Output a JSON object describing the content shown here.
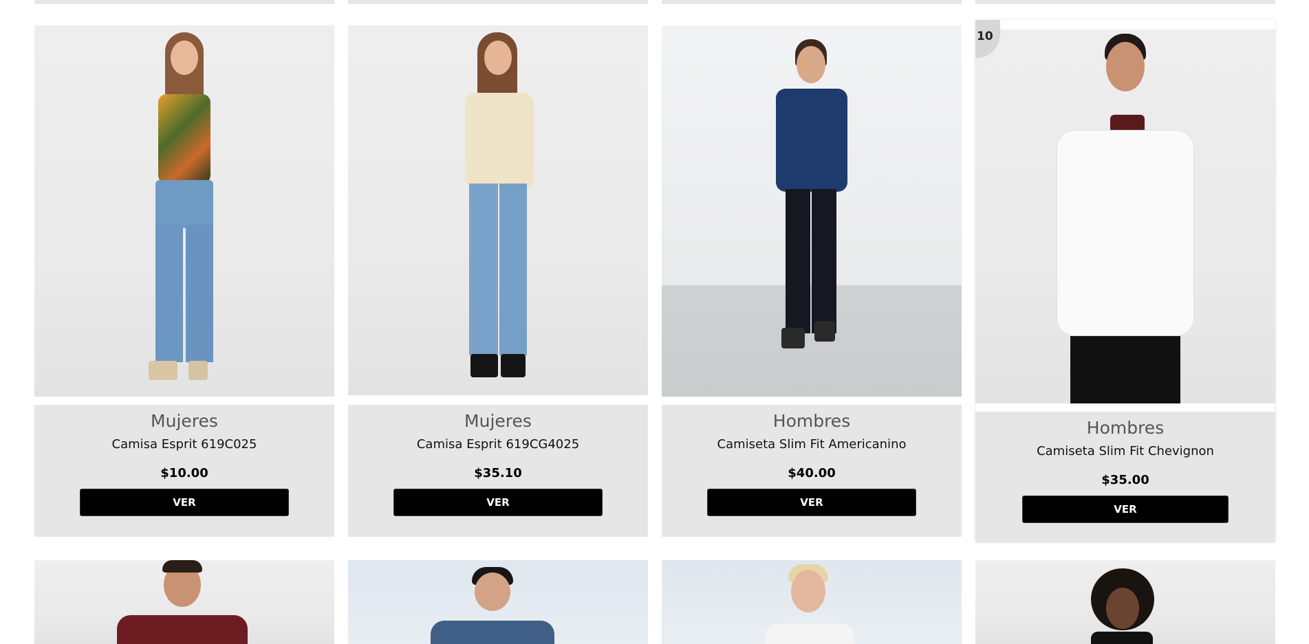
{
  "products": [
    {
      "category": "Mujeres",
      "name": "Camisa Esprit 619C025",
      "price": "$10.00",
      "button": "VER"
    },
    {
      "category": "Mujeres",
      "name": "Camisa Esprit 619CG4025",
      "price": "$35.10",
      "button": "VER"
    },
    {
      "category": "Hombres",
      "name": "Camiseta Slim Fit Americanino",
      "price": "$40.00",
      "button": "VER"
    },
    {
      "category": "Hombres",
      "name": "Camiseta Slim Fit Chevignon",
      "price": "$35.00",
      "button": "VER",
      "badge": "10"
    }
  ]
}
